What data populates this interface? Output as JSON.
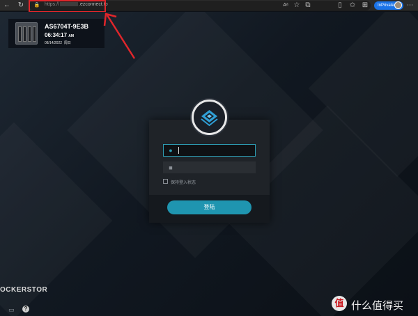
{
  "browser": {
    "url_scheme": "https://",
    "url_domain": ".ezconnect.to",
    "badge": "InPrivate",
    "toolbar_icons": [
      "back-icon",
      "refresh-icon",
      "lock-icon",
      "read-aloud-icon",
      "favorites-icon",
      "extensions-icon",
      "collections-icon",
      "split-screen-icon",
      "menu-icon"
    ]
  },
  "device": {
    "name": "AS6704T-9E3B",
    "time": "06:34:17",
    "ampm": "AM",
    "date": "08/14/2022",
    "weekday": "周日"
  },
  "login": {
    "remember_label": "保持登入状态",
    "submit_label": "登陆"
  },
  "brand": "OCKERSTOR",
  "watermark": {
    "logo_char": "值",
    "text": "什么值得买"
  },
  "colors": {
    "accent": "#1f95b0",
    "annotation": "#e0262b",
    "inprivate": "#1a73e8"
  }
}
